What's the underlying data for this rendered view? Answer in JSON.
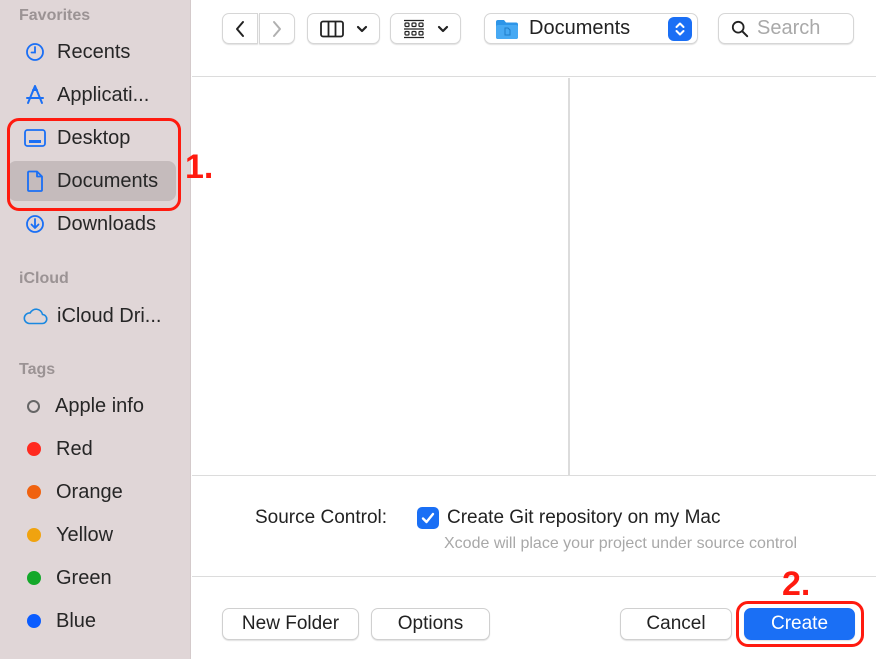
{
  "sidebar": {
    "sections": [
      {
        "title": "Favorites",
        "items": [
          {
            "label": "Recents",
            "icon": "clock-icon"
          },
          {
            "label": "Applicati...",
            "icon": "applications-icon"
          },
          {
            "label": "Desktop",
            "icon": "desktop-icon"
          },
          {
            "label": "Documents",
            "icon": "document-icon",
            "selected": true
          },
          {
            "label": "Downloads",
            "icon": "download-icon"
          }
        ]
      },
      {
        "title": "iCloud",
        "items": [
          {
            "label": "iCloud Dri...",
            "icon": "cloud-icon"
          }
        ]
      },
      {
        "title": "Tags",
        "items": [
          {
            "label": "Apple info",
            "color": "#666666",
            "hollow": true
          },
          {
            "label": "Red",
            "color": "#ff2a1f"
          },
          {
            "label": "Orange",
            "color": "#f0620f"
          },
          {
            "label": "Yellow",
            "color": "#f0a30f"
          },
          {
            "label": "Green",
            "color": "#14a82a"
          },
          {
            "label": "Blue",
            "color": "#0a5cff"
          }
        ]
      }
    ]
  },
  "toolbar": {
    "back_icon": "chevron-left-icon",
    "forward_icon": "chevron-right-icon",
    "view_mode_icon": "columns-icon",
    "group_icon": "grid-icon",
    "location": "Documents",
    "search_placeholder": "Search"
  },
  "options": {
    "source_control_label": "Source Control:",
    "git_checkbox_label": "Create Git repository on my Mac",
    "git_checked": true,
    "git_hint": "Xcode will place your project under source control"
  },
  "buttons": {
    "new_folder": "New Folder",
    "options": "Options",
    "cancel": "Cancel",
    "create": "Create"
  },
  "annotations": {
    "step1": "1.",
    "step2": "2."
  },
  "colors": {
    "accent": "#1a6ff5",
    "annotation": "#ff1a0f",
    "sidebar_bg": "#e0d6d7"
  }
}
